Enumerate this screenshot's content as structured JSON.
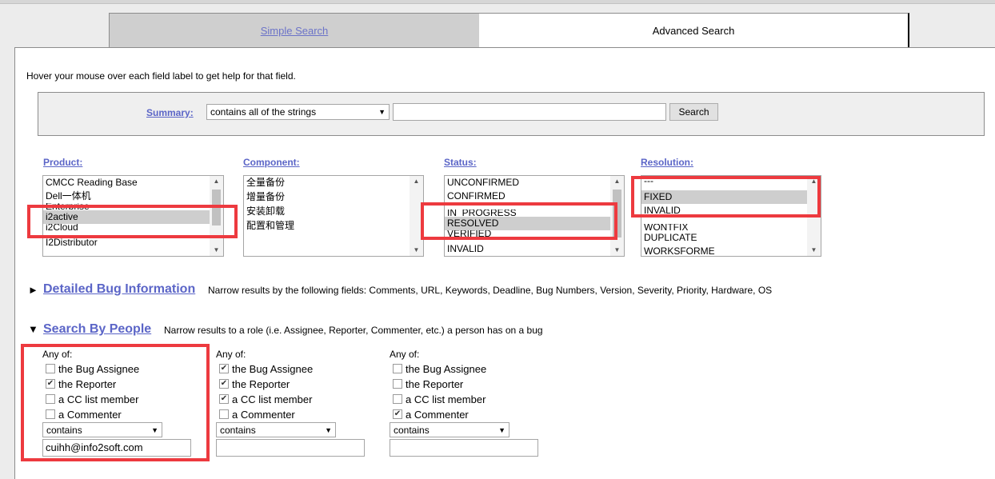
{
  "tabs": {
    "simple": "Simple Search",
    "advanced": "Advanced Search"
  },
  "help_text": "Hover your mouse over each field label to get help for that field.",
  "summary": {
    "label": "Summary:",
    "operator": "contains all of the strings",
    "value": "",
    "search_button": "Search"
  },
  "fields": {
    "product": {
      "label": "Product:",
      "options": [
        "CMCC Reading Base",
        "Dell一体机",
        "Enterprise",
        "i2active",
        "i2Cloud",
        "I2Distributor"
      ],
      "selected": "i2active"
    },
    "component": {
      "label": "Component:",
      "options": [
        "全量备份",
        "增量备份",
        "安装卸载",
        "配置和管理"
      ]
    },
    "status": {
      "label": "Status:",
      "options": [
        "UNCONFIRMED",
        "CONFIRMED",
        "IN_PROGRESS",
        "RESOLVED",
        "VERIFIED",
        "INVALID"
      ],
      "selected": "RESOLVED"
    },
    "resolution": {
      "label": "Resolution:",
      "options": [
        "---",
        "FIXED",
        "INVALID",
        "WONTFIX",
        "DUPLICATE",
        "WORKSFORME"
      ],
      "selected": "FIXED"
    }
  },
  "detailed": {
    "toggle": "►",
    "title": "Detailed Bug Information",
    "desc": "Narrow results by the following fields: Comments, URL, Keywords, Deadline, Bug Numbers, Version, Severity, Priority, Hardware, OS"
  },
  "people": {
    "toggle": "▼",
    "title": "Search By People",
    "desc": "Narrow results to a role (i.e. Assignee, Reporter, Commenter, etc.) a person has on a bug",
    "columns": [
      {
        "anyof": "Any of:",
        "assignee": "the Bug Assignee",
        "reporter": "the Reporter",
        "cc": "a CC list member",
        "commenter": "a Commenter",
        "checked": {
          "assignee": false,
          "reporter": true,
          "cc": false,
          "commenter": false
        },
        "operator": "contains",
        "value": "cuihh@info2soft.com"
      },
      {
        "anyof": "Any of:",
        "assignee": "the Bug Assignee",
        "reporter": "the Reporter",
        "cc": "a CC list member",
        "commenter": "a Commenter",
        "checked": {
          "assignee": true,
          "reporter": true,
          "cc": true,
          "commenter": false
        },
        "operator": "contains",
        "value": ""
      },
      {
        "anyof": "Any of:",
        "assignee": "the Bug Assignee",
        "reporter": "the Reporter",
        "cc": "a CC list member",
        "commenter": "a Commenter",
        "checked": {
          "assignee": false,
          "reporter": false,
          "cc": false,
          "commenter": true
        },
        "operator": "contains",
        "value": ""
      }
    ]
  },
  "icons": {
    "check": "✔",
    "dropdown": "▼",
    "scroll_up": "▲",
    "scroll_down": "▼"
  },
  "colors": {
    "link": "#5b65c7",
    "highlight": "#ed3a3f"
  }
}
